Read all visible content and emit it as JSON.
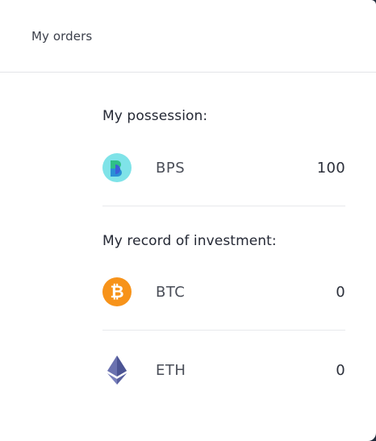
{
  "header": {
    "title": "My orders"
  },
  "possession": {
    "title": "My possession:",
    "items": [
      {
        "name": "BPS",
        "amount": "100",
        "icon": "bps-coin-icon"
      }
    ]
  },
  "investment": {
    "title": "My record of investment:",
    "items": [
      {
        "name": "BTC",
        "amount": "0",
        "icon": "bitcoin-icon"
      },
      {
        "name": "ETH",
        "amount": "0",
        "icon": "ethereum-icon"
      }
    ]
  },
  "colors": {
    "bps_bg": "#7fe3e8",
    "btc_bg": "#f7931a",
    "eth": "#6b72b0"
  }
}
